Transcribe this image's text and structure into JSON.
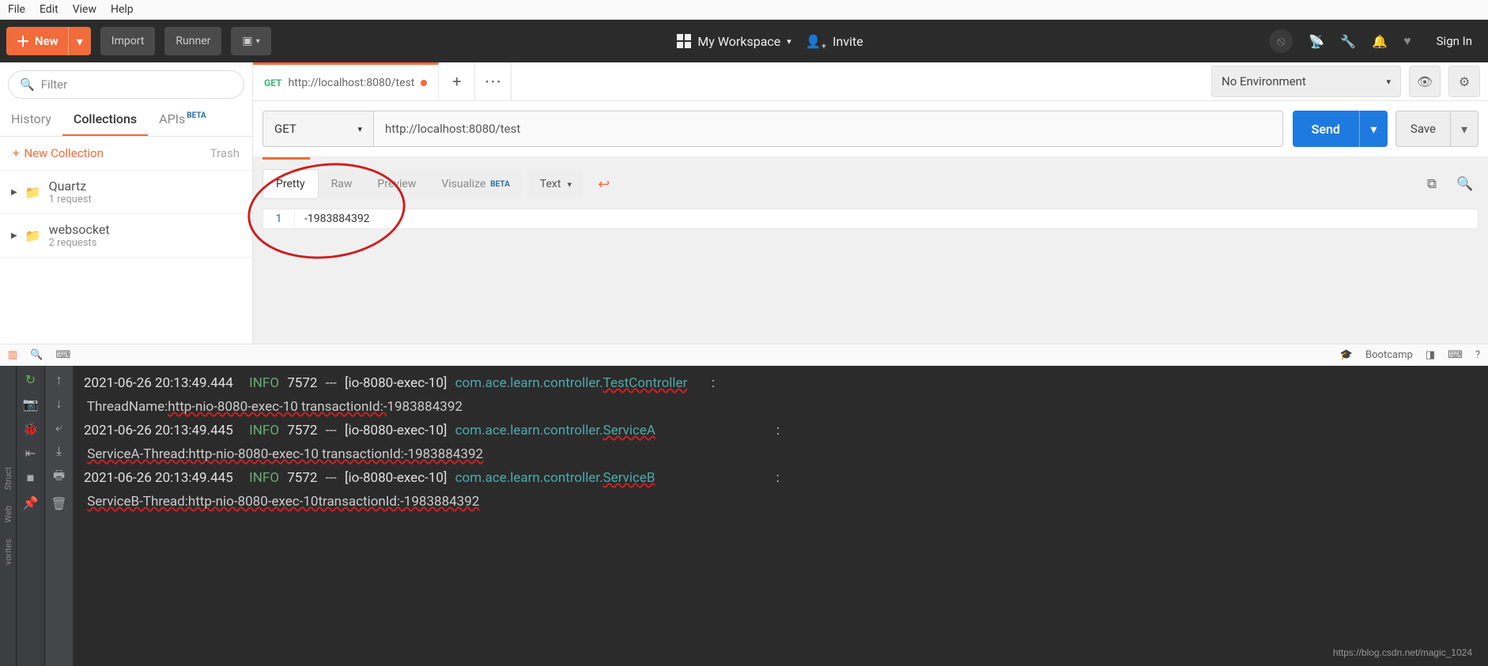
{
  "menubar": [
    "File",
    "Edit",
    "View",
    "Help"
  ],
  "toolbar": {
    "new_label": "New",
    "import_label": "Import",
    "runner_label": "Runner",
    "workspace_label": "My Workspace",
    "invite_label": "Invite",
    "signin_label": "Sign In"
  },
  "sidebar": {
    "filter_placeholder": "Filter",
    "tabs": {
      "history": "History",
      "collections": "Collections",
      "apis": "APIs",
      "beta": "BETA"
    },
    "new_collection": "New Collection",
    "trash": "Trash",
    "collections": [
      {
        "name": "Quartz",
        "sub": "1 request"
      },
      {
        "name": "websocket",
        "sub": "2 requests"
      }
    ]
  },
  "request": {
    "tab_method": "GET",
    "tab_url": "http://localhost:8080/test",
    "method": "GET",
    "url": "http://localhost:8080/test",
    "send": "Send",
    "save": "Save"
  },
  "env": {
    "selected": "No Environment"
  },
  "response": {
    "tabs": {
      "pretty": "Pretty",
      "raw": "Raw",
      "preview": "Preview",
      "visualize": "Visualize",
      "beta": "BETA"
    },
    "text_sel": "Text",
    "line_no": "1",
    "body": "-1983884392"
  },
  "statusbar": {
    "bootcamp": "Bootcamp"
  },
  "console": {
    "lines": [
      {
        "ts": "2021-06-26 20:13:49.444",
        "level": "INFO",
        "pid": "7572",
        "sep": "---",
        "thread": "[io-8080-exec-10]",
        "cls_pre": "com.ace.learn.controller.",
        "cls_hl": "TestController",
        "colon": ":"
      },
      {
        "msg_pre": " ThreadName:",
        "msg_hl": "http-nio-8080-exec-10 transactionId:-",
        "msg_post": "1983884392"
      },
      {
        "ts": "2021-06-26 20:13:49.445",
        "level": "INFO",
        "pid": "7572",
        "sep": "---",
        "thread": "[io-8080-exec-10]",
        "cls_pre": "com.ace.learn.controller.",
        "cls_hl": "ServiceA",
        "colon": ":"
      },
      {
        "msg_pre": " ",
        "msg_hl": "ServiceA-Thread:http-nio-8080-exec-10 transactionId:-1983884392",
        "msg_post": ""
      },
      {
        "ts": "2021-06-26 20:13:49.445",
        "level": "INFO",
        "pid": "7572",
        "sep": "---",
        "thread": "[io-8080-exec-10]",
        "cls_pre": "com.ace.learn.controller.",
        "cls_hl": "ServiceB",
        "colon": ":"
      },
      {
        "msg_pre": " ",
        "msg_hl": "ServiceB-Thread:http-nio-8080-exec-10transactionId:-1983884392",
        "msg_post": ""
      }
    ],
    "watermark": "https://blog.csdn.net/magic_1024"
  }
}
